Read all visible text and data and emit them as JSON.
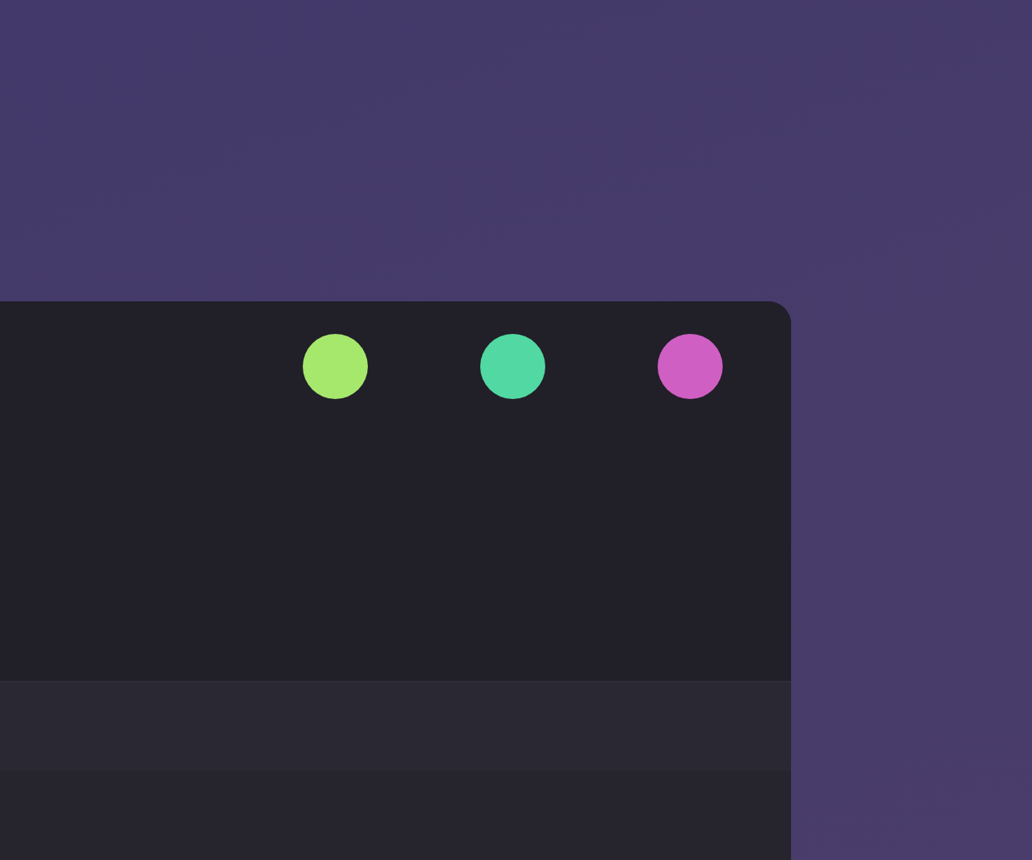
{
  "window": {
    "controls": [
      {
        "color": "#a6e86c"
      },
      {
        "color": "#52d8a2"
      },
      {
        "color": "#d05fc4"
      }
    ]
  }
}
